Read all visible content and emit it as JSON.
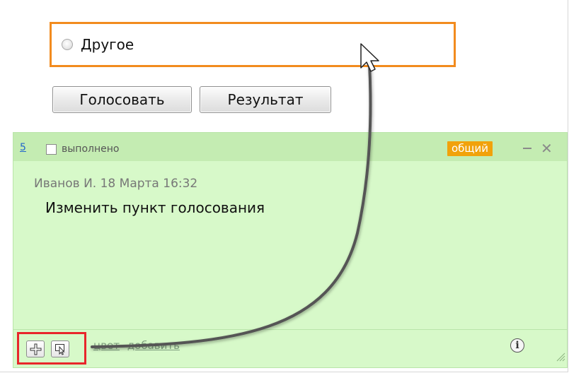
{
  "poll": {
    "option_label": "Другое",
    "vote_button": "Голосовать",
    "result_button": "Результат"
  },
  "note": {
    "number": "5",
    "done_label": "выполнено",
    "tag": "общий",
    "author_line": "Иванов И. 18 Марта 16:32",
    "text": "Изменить пункт голосования",
    "footer_link_color": "цвет",
    "footer_link_add": "добавить",
    "info_symbol": "i",
    "background_color": "#d7f9c9",
    "tag_color": "#f1a20b"
  },
  "highlights": {
    "poll_option_border": "#f28b1e",
    "tools_border": "#e8262b"
  }
}
